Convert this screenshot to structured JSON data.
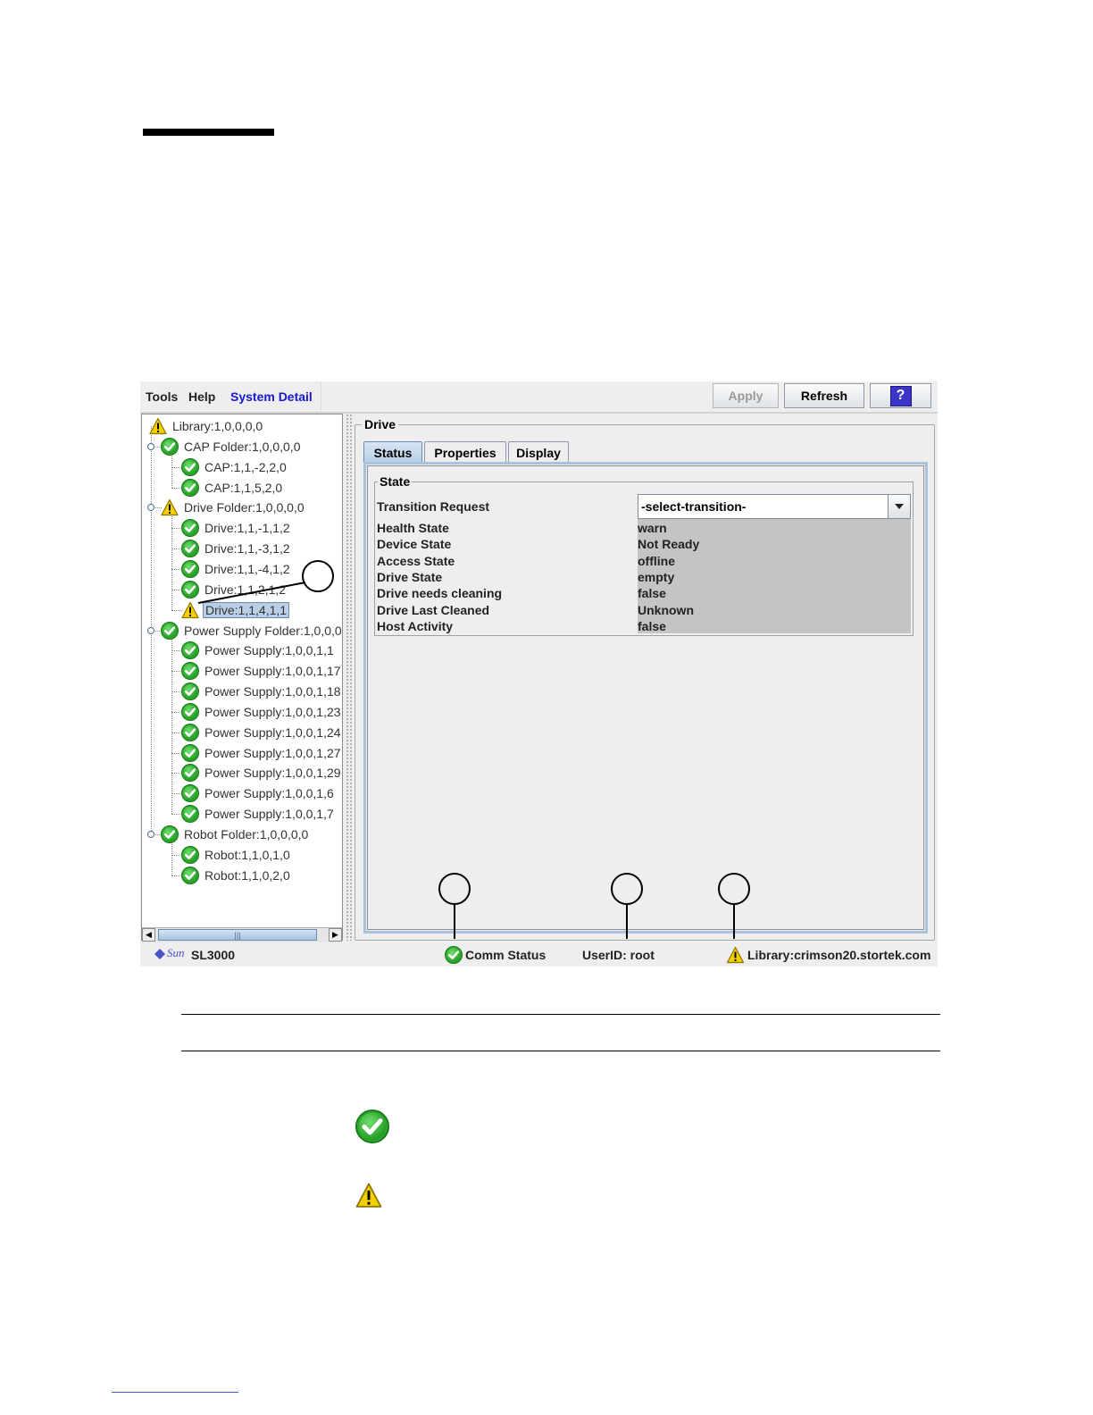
{
  "menubar": {
    "items": [
      {
        "label": "Tools"
      },
      {
        "label": "Help"
      },
      {
        "label": "System Detail"
      }
    ],
    "buttons": {
      "apply": "Apply",
      "refresh": "Refresh",
      "help": "?"
    }
  },
  "tree": {
    "nodes": [
      {
        "label": "Library:1,0,0,0,0",
        "status": "warning"
      },
      {
        "label": "CAP Folder:1,0,0,0,0",
        "status": "ok"
      },
      {
        "label": "CAP:1,1,-2,2,0",
        "status": "ok"
      },
      {
        "label": "CAP:1,1,5,2,0",
        "status": "ok"
      },
      {
        "label": "Drive Folder:1,0,0,0,0",
        "status": "warning"
      },
      {
        "label": "Drive:1,1,-1,1,2",
        "status": "ok"
      },
      {
        "label": "Drive:1,1,-3,1,2",
        "status": "ok"
      },
      {
        "label": "Drive:1,1,-4,1,2",
        "status": "ok"
      },
      {
        "label": "Drive:1,1,2,1,2",
        "status": "ok"
      },
      {
        "label": "Drive:1,1,4,1,1",
        "status": "warning"
      },
      {
        "label": "Power Supply Folder:1,0,0,0,",
        "status": "ok"
      },
      {
        "label": "Power Supply:1,0,0,1,1",
        "status": "ok"
      },
      {
        "label": "Power Supply:1,0,0,1,17",
        "status": "ok"
      },
      {
        "label": "Power Supply:1,0,0,1,18",
        "status": "ok"
      },
      {
        "label": "Power Supply:1,0,0,1,23",
        "status": "ok"
      },
      {
        "label": "Power Supply:1,0,0,1,24",
        "status": "ok"
      },
      {
        "label": "Power Supply:1,0,0,1,27",
        "status": "ok"
      },
      {
        "label": "Power Supply:1,0,0,1,29",
        "status": "ok"
      },
      {
        "label": "Power Supply:1,0,0,1,6",
        "status": "ok"
      },
      {
        "label": "Power Supply:1,0,0,1,7",
        "status": "ok"
      },
      {
        "label": "Robot Folder:1,0,0,0,0",
        "status": "ok"
      },
      {
        "label": "Robot:1,1,0,1,0",
        "status": "ok"
      },
      {
        "label": "Robot:1,1,0,2,0",
        "status": "ok"
      }
    ],
    "scroll_thumb_glyph": "|||"
  },
  "panel": {
    "title": "Drive",
    "tabs": [
      {
        "label": "Status"
      },
      {
        "label": "Properties"
      },
      {
        "label": "Display"
      }
    ],
    "state": {
      "title": "State",
      "transition_label": "Transition Request",
      "transition_value": "-select-transition-",
      "rows": [
        {
          "label": "Health State",
          "value": "warn"
        },
        {
          "label": "Device State",
          "value": "Not Ready"
        },
        {
          "label": "Access State",
          "value": "offline"
        },
        {
          "label": "Drive State",
          "value": "empty"
        },
        {
          "label": "Drive needs cleaning",
          "value": "false"
        },
        {
          "label": "Drive Last Cleaned",
          "value": "Unknown"
        },
        {
          "label": "Host Activity",
          "value": "false"
        }
      ]
    }
  },
  "statusbar": {
    "logo": "Sun",
    "product": "SL3000",
    "comm_status": "Comm Status",
    "user": "UserID: root",
    "library": "Library:crimson20.stortek.com"
  },
  "colors": {
    "ok_green": "#2aa82a",
    "warning_yellow": "#f5d000",
    "menu_active": "#1717d6",
    "tab_selected": "#b7cde5"
  }
}
